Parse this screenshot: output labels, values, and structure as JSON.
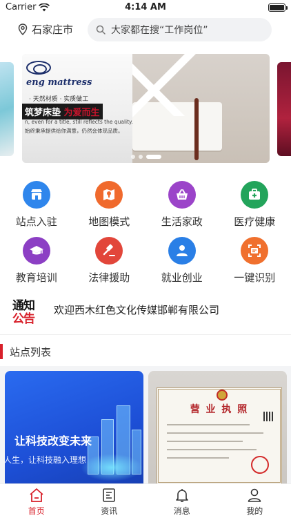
{
  "status_bar": {
    "carrier": "Carrier",
    "time": "4:14 AM"
  },
  "header": {
    "city": "石家庄市",
    "search_placeholder": "大家都在搜“工作岗位”"
  },
  "banner": {
    "brand": "eng mattress",
    "tagline1": "· 天然材质 · 实质做工",
    "slogan_a": "筑梦床垫",
    "slogan_b": "为爱而生",
    "tagline2": "n, even for a title, still reflects the quality.",
    "tagline3": "始终秉承提供给你满意，仍然会体现品质。",
    "active_page": 2,
    "page_count": 3
  },
  "categories": [
    {
      "label": "站点入驻",
      "icon": "shop-icon",
      "color": "#2f86ec"
    },
    {
      "label": "地图模式",
      "icon": "map-icon",
      "color": "#f06a2d"
    },
    {
      "label": "生活家政",
      "icon": "basket-icon",
      "color": "#9b44c9"
    },
    {
      "label": "医疗健康",
      "icon": "medical-kit-icon",
      "color": "#23a45b"
    },
    {
      "label": "教育培训",
      "icon": "graduation-cap-icon",
      "color": "#8c3fc4"
    },
    {
      "label": "法律援助",
      "icon": "gavel-icon",
      "color": "#e2463a"
    },
    {
      "label": "就业创业",
      "icon": "person-icon",
      "color": "#2a7fe6"
    },
    {
      "label": "一键识别",
      "icon": "scan-icon",
      "color": "#f0702e"
    }
  ],
  "notice": {
    "badge_top": "通知",
    "badge_bottom": "公告",
    "text": "欢迎西木红色文化传媒邯郸有限公司"
  },
  "section": {
    "title": "站点列表"
  },
  "cards": [
    {
      "headline": "让科技改变未来",
      "subtitle": "人生，让科技融入理想"
    },
    {
      "title": "营 业 执 照"
    }
  ],
  "tabbar": [
    {
      "label": "首页",
      "icon": "home-icon",
      "active": true
    },
    {
      "label": "资讯",
      "icon": "news-icon",
      "active": false
    },
    {
      "label": "消息",
      "icon": "bell-icon",
      "active": false
    },
    {
      "label": "我的",
      "icon": "user-icon",
      "active": false
    }
  ],
  "colors": {
    "accent": "#d8202a",
    "search_bg": "#f1f2f4",
    "card_blue": "#2a6bf0"
  }
}
